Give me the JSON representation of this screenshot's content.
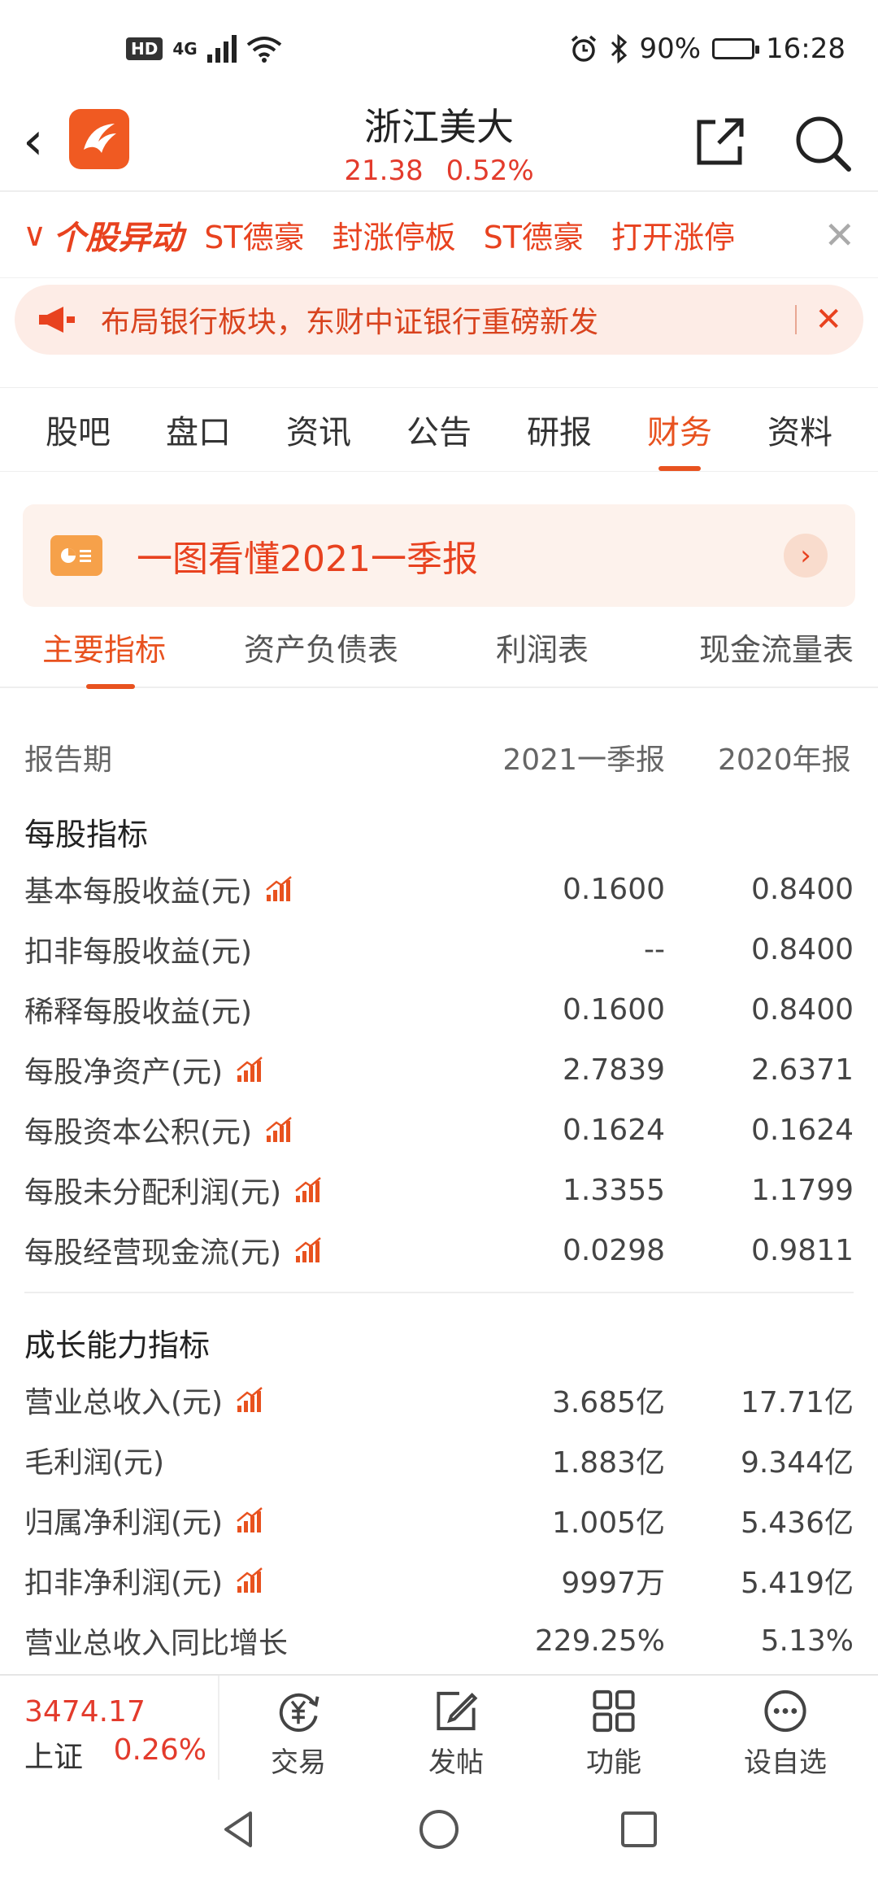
{
  "status_bar": {
    "network_badge": "HD",
    "network_type": "4G",
    "battery": "90%",
    "battery_level": 0.9,
    "time": "16:28"
  },
  "header": {
    "title": "浙江美大",
    "price": "21.38",
    "change": "0.52%"
  },
  "ticker": {
    "brand": "个股异动",
    "items": [
      "ST德豪",
      "封涨停板",
      "ST德豪",
      "打开涨停"
    ]
  },
  "banner": {
    "text": "布局银行板块，东财中证银行重磅新发"
  },
  "tabs": [
    "股吧",
    "盘口",
    "资讯",
    "公告",
    "研报",
    "财务",
    "资料"
  ],
  "active_tab": "财务",
  "promo": {
    "text": "一图看懂2021一季报"
  },
  "subtabs": [
    "主要指标",
    "资产负债表",
    "利润表",
    "现金流量表"
  ],
  "table": {
    "header": {
      "label": "报告期",
      "col1": "2021一季报",
      "col2": "2020年报"
    },
    "sections": [
      {
        "title": "每股指标",
        "rows": [
          {
            "label": "基本每股收益(元)",
            "v1": "0.1600",
            "v2": "0.8400",
            "chart": true
          },
          {
            "label": "扣非每股收益(元)",
            "v1": "--",
            "v2": "0.8400",
            "chart": false
          },
          {
            "label": "稀释每股收益(元)",
            "v1": "0.1600",
            "v2": "0.8400",
            "chart": false
          },
          {
            "label": "每股净资产(元)",
            "v1": "2.7839",
            "v2": "2.6371",
            "chart": true
          },
          {
            "label": "每股资本公积(元)",
            "v1": "0.1624",
            "v2": "0.1624",
            "chart": true
          },
          {
            "label": "每股未分配利润(元)",
            "v1": "1.3355",
            "v2": "1.1799",
            "chart": true
          },
          {
            "label": "每股经营现金流(元)",
            "v1": "0.0298",
            "v2": "0.9811",
            "chart": true
          }
        ]
      },
      {
        "title": "成长能力指标",
        "rows": [
          {
            "label": "营业总收入(元)",
            "v1": "3.685亿",
            "v2": "17.71亿",
            "chart": true
          },
          {
            "label": "毛利润(元)",
            "v1": "1.883亿",
            "v2": "9.344亿",
            "chart": false
          },
          {
            "label": "归属净利润(元)",
            "v1": "1.005亿",
            "v2": "5.436亿",
            "chart": true
          },
          {
            "label": "扣非净利润(元)",
            "v1": "9997万",
            "v2": "5.419亿",
            "chart": true
          },
          {
            "label": "营业总收入同比增长",
            "v1": "229.25%",
            "v2": "5.13%",
            "chart": false
          }
        ]
      }
    ]
  },
  "bottom_bar": {
    "index_value": "3474.17",
    "index_name": "上证",
    "index_change": "0.26%",
    "nav": [
      "交易",
      "发帖",
      "功能",
      "设自选"
    ]
  },
  "colors": {
    "accent": "#e8521f",
    "up": "#e33b2c",
    "banner_bg": "#fdece6"
  }
}
